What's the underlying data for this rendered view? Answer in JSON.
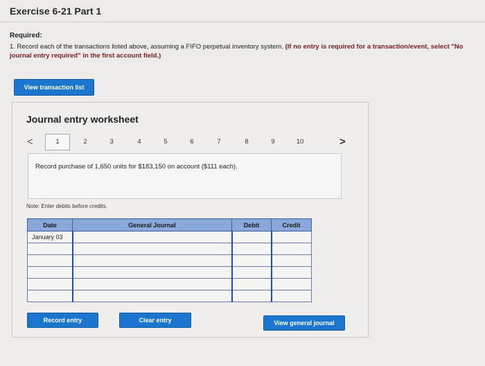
{
  "header": {
    "title": "Exercise 6-21 Part 1",
    "required_label": "Required:",
    "instruction": "1. Record each of the transactions listed above, assuming a FIFO perpetual inventory system.",
    "instruction_bold": "(If no entry is required for a transaction/event, select \"No journal entry required\" in the first account field.)"
  },
  "buttons": {
    "view_transaction_list": "View transaction list",
    "record_entry": "Record entry",
    "clear_entry": "Clear entry",
    "view_general_journal": "View general journal"
  },
  "worksheet": {
    "title": "Journal entry worksheet",
    "prev_arrow": "<",
    "next_arrow": ">",
    "pages": [
      "1",
      "2",
      "3",
      "4",
      "5",
      "6",
      "7",
      "8",
      "9",
      "10"
    ],
    "active_page": "1",
    "description": "Record purchase of 1,650 units for $183,150 on account ($111 each).",
    "note": "Note: Enter debits before credits."
  },
  "journal_table": {
    "headers": [
      "Date",
      "General Journal",
      "Debit",
      "Credit"
    ],
    "rows": [
      {
        "date": "January 03",
        "account": "",
        "debit": "",
        "credit": ""
      },
      {
        "date": "",
        "account": "",
        "debit": "",
        "credit": ""
      },
      {
        "date": "",
        "account": "",
        "debit": "",
        "credit": ""
      },
      {
        "date": "",
        "account": "",
        "debit": "",
        "credit": ""
      },
      {
        "date": "",
        "account": "",
        "debit": "",
        "credit": ""
      },
      {
        "date": "",
        "account": "",
        "debit": "",
        "credit": ""
      }
    ]
  },
  "colors": {
    "accent_button": "#1c76cf",
    "table_header": "#8aa7da",
    "instruction_bold": "#7a2020"
  }
}
